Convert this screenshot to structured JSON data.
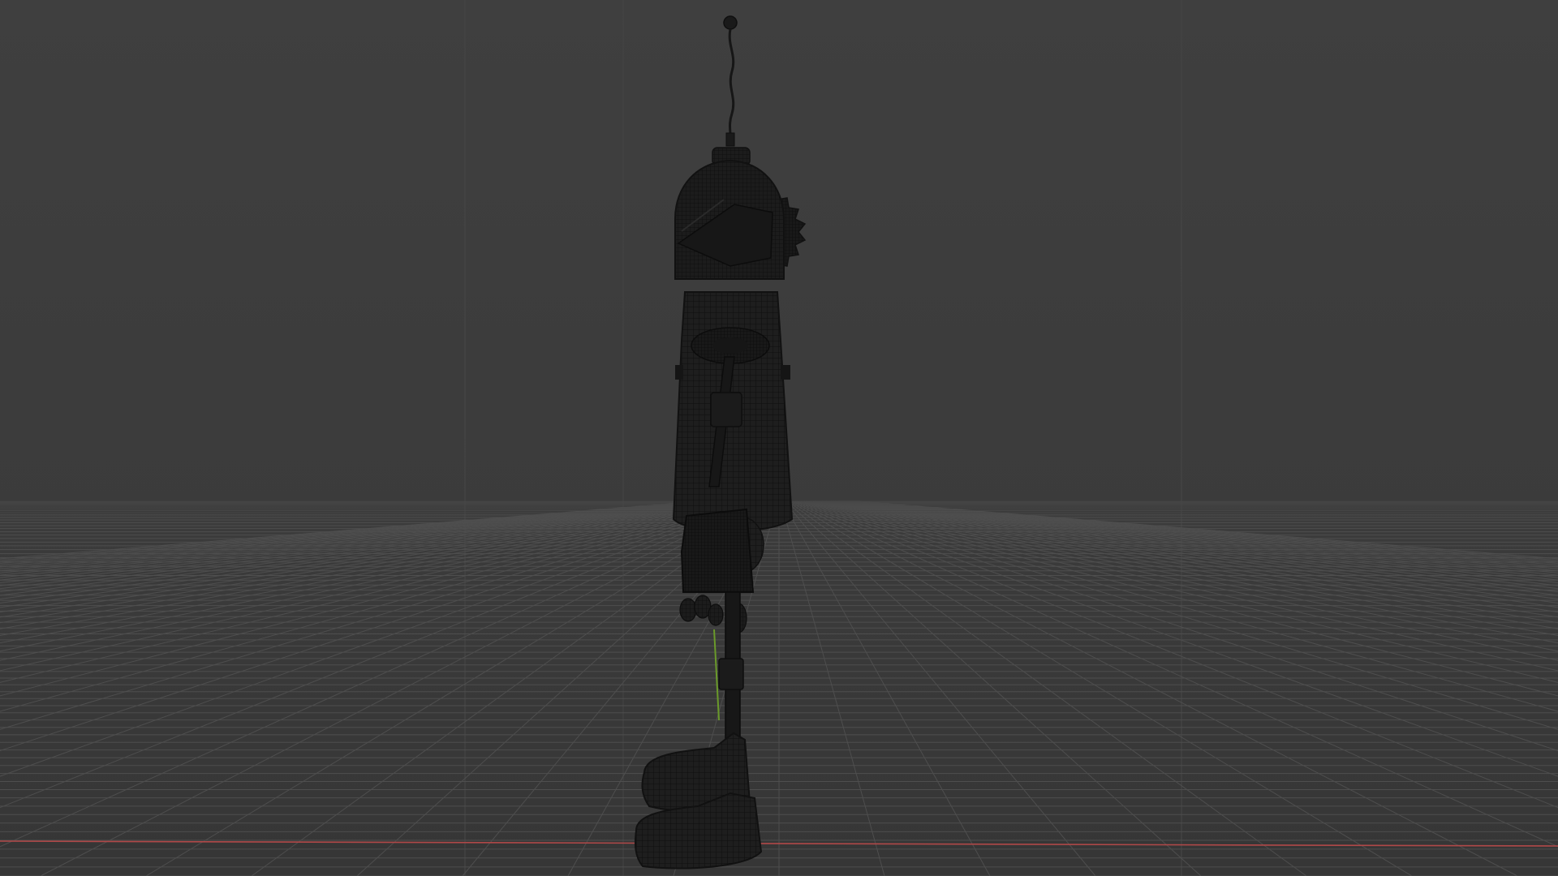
{
  "viewport": {
    "mode": "3d-viewport",
    "shading": "wireframe",
    "view": "side",
    "grid": true,
    "horizon": "visible"
  },
  "colors": {
    "background_top": "#3f3f3f",
    "background_bottom": "#353535",
    "grid_line": "#4e4e4e",
    "grid_line_far": "#474747",
    "axis_x": "#b04848",
    "axis_y": "#6a9a2a",
    "model_fill": "#1e1e1e",
    "model_wire": "#0e0e0e",
    "model_edge": "#151515"
  },
  "scene": {
    "objects": [
      {
        "name": "robot-antenna"
      },
      {
        "name": "robot-head"
      },
      {
        "name": "robot-head-gear"
      },
      {
        "name": "robot-body"
      },
      {
        "name": "robot-shoulder-ring"
      },
      {
        "name": "robot-arm"
      },
      {
        "name": "robot-hip"
      },
      {
        "name": "robot-hand"
      },
      {
        "name": "robot-leg"
      },
      {
        "name": "robot-foot-back"
      },
      {
        "name": "robot-foot-front"
      }
    ]
  }
}
